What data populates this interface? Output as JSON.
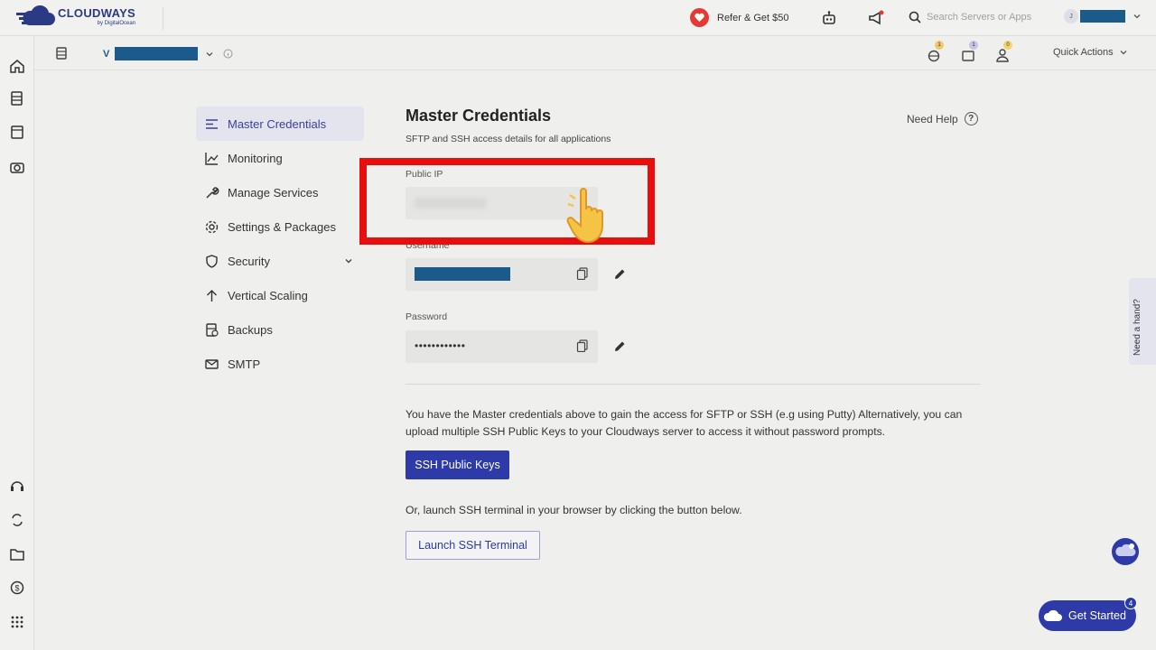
{
  "brand": {
    "name": "CLOUDWAYS",
    "sub": "by DigitalOcean"
  },
  "topbar": {
    "refer_label": "Refer & Get $50",
    "search_placeholder": "Search Servers or Apps",
    "user_initial": "J"
  },
  "subbar": {
    "server_badge": "V",
    "quick_actions_label": "Quick Actions",
    "badges": [
      "1",
      "1",
      "0"
    ]
  },
  "menu": {
    "items": [
      {
        "label": "Master Credentials",
        "icon": "list-icon",
        "active": true
      },
      {
        "label": "Monitoring",
        "icon": "chart-line-icon"
      },
      {
        "label": "Manage Services",
        "icon": "wrench-icon"
      },
      {
        "label": "Settings & Packages",
        "icon": "gear-icon"
      },
      {
        "label": "Security",
        "icon": "shield-icon",
        "expandable": true
      },
      {
        "label": "Vertical Scaling",
        "icon": "arrow-up-icon"
      },
      {
        "label": "Backups",
        "icon": "backup-icon"
      },
      {
        "label": "SMTP",
        "icon": "mail-icon"
      }
    ]
  },
  "main": {
    "title": "Master Credentials",
    "subtitle": "SFTP and SSH access details for all applications",
    "need_help": "Need Help",
    "public_ip_label": "Public IP",
    "username_label": "Username",
    "password_label": "Password",
    "password_value": "••••••••••••",
    "info_text": "You have the Master credentials above to gain the access for SFTP or SSH (e.g using Putty) Alternatively, you can upload multiple SSH Public Keys to your Cloudways server to access it without password prompts.",
    "ssh_keys_button": "SSH Public Keys",
    "info_text2": "Or, launch SSH terminal in your browser by clicking the button below.",
    "launch_terminal_button": "Launch SSH Terminal"
  },
  "floating": {
    "need_hand": "Need a hand?",
    "get_started": "Get Started",
    "get_started_badge": "4"
  },
  "colors": {
    "accent": "#2d3aa8",
    "highlight": "#e80e0e",
    "mask": "#1c5a8c"
  }
}
